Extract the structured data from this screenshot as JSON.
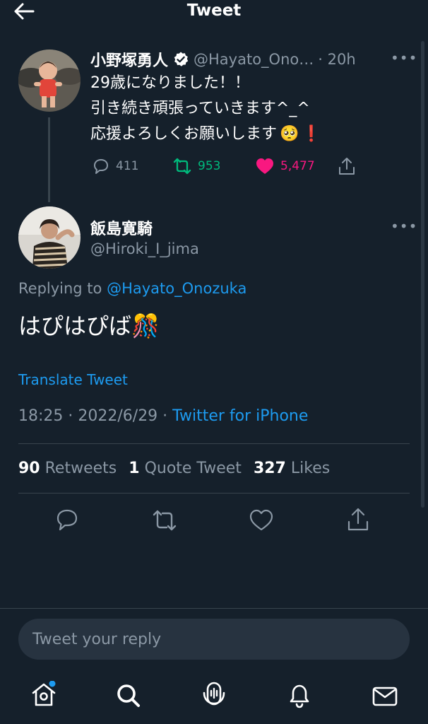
{
  "header": {
    "title": "Tweet"
  },
  "parent_tweet": {
    "name": "小野塚勇人",
    "handle": "@Hayato_Ono…",
    "time": "· 20h",
    "lines": [
      "29歳になりました！！",
      "引き続き頑張っていきます^_^",
      "応援よろしくお願いします"
    ],
    "emoji_pleading": "🥺",
    "emoji_exclaim": "❗",
    "replies": "411",
    "retweets": "953",
    "likes": "5,477"
  },
  "main_tweet": {
    "name": "飯島寛騎",
    "handle": "@Hiroki_I_jima",
    "replying_prefix": "Replying to",
    "replying_to": "@Hayato_Onozuka",
    "text": "はぴはぴば",
    "text_emoji": "🎊",
    "translate": "Translate Tweet",
    "time_date": "18:25 · 2022/6/29 ·",
    "source": "Twitter for iPhone",
    "retweet_count": "90",
    "retweet_label": "Retweets",
    "quote_count": "1",
    "quote_label": "Quote Tweet",
    "like_count": "327",
    "like_label": "Likes"
  },
  "reply_box": {
    "placeholder": "Tweet your reply"
  },
  "colors": {
    "background": "#15202b",
    "accent": "#1d9bf0",
    "retweet": "#00ba7c",
    "like": "#f91880"
  },
  "icons": {
    "nav": [
      "home-icon",
      "search-icon",
      "spaces-icon",
      "notifications-icon",
      "messages-icon"
    ]
  }
}
